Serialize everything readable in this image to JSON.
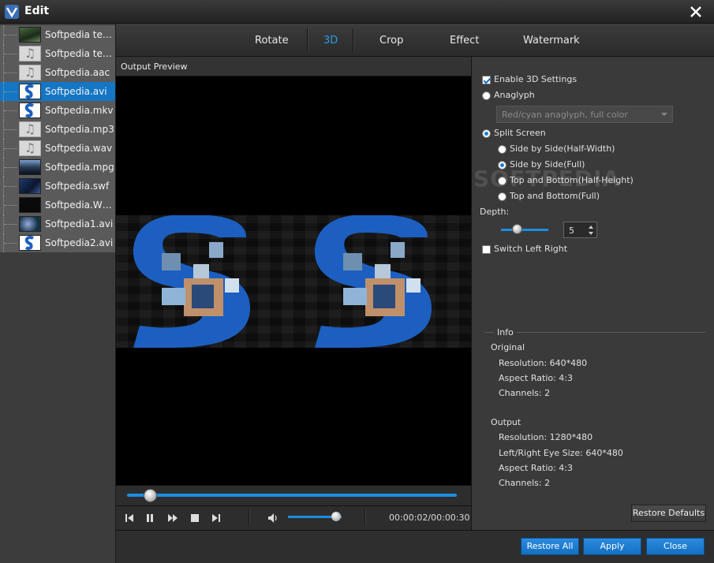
{
  "window": {
    "title": "Edit"
  },
  "files": [
    {
      "name": "Softpedia test ...",
      "thumb": "nature"
    },
    {
      "name": "Softpedia test....",
      "thumb": "note"
    },
    {
      "name": "Softpedia.aac",
      "thumb": "note"
    },
    {
      "name": "Softpedia.avi",
      "thumb": "logo",
      "selected": true
    },
    {
      "name": "Softpedia.mkv",
      "thumb": "logo"
    },
    {
      "name": "Softpedia.mp3",
      "thumb": "note"
    },
    {
      "name": "Softpedia.wav",
      "thumb": "note"
    },
    {
      "name": "Softpedia.mpg",
      "thumb": "city"
    },
    {
      "name": "Softpedia.swf",
      "thumb": "video"
    },
    {
      "name": "Softpedia.WMV",
      "thumb": "dark"
    },
    {
      "name": "Softpedia1.avi",
      "thumb": "sea"
    },
    {
      "name": "Softpedia2.avi",
      "thumb": "logo"
    }
  ],
  "tabs": [
    {
      "label": "Rotate"
    },
    {
      "label": "3D",
      "active": true
    },
    {
      "label": "Crop"
    },
    {
      "label": "Effect"
    },
    {
      "label": "Watermark"
    }
  ],
  "preview": {
    "label": "Output Preview",
    "seek_progress": 0.07,
    "volume": 0.9
  },
  "playback": {
    "time": "00:00:02/00:00:30"
  },
  "settings": {
    "enable_3d": {
      "label": "Enable 3D Settings",
      "checked": true
    },
    "anaglyph": {
      "label": "Anaglyph",
      "selected": false
    },
    "anaglyph_mode": "Red/cyan anaglyph, full color",
    "split_screen": {
      "label": "Split Screen",
      "selected": true
    },
    "split_options": [
      {
        "label": "Side by Side(Half-Width)",
        "selected": false
      },
      {
        "label": "Side by Side(Full)",
        "selected": true
      },
      {
        "label": "Top and Bottom(Half-Height)",
        "selected": false
      },
      {
        "label": "Top and Bottom(Full)",
        "selected": false
      }
    ],
    "depth_label": "Depth:",
    "depth_value": "5",
    "switch_left_right": {
      "label": "Switch Left Right",
      "checked": false
    }
  },
  "info": {
    "title": "Info",
    "original_label": "Original",
    "original": [
      "Resolution: 640*480",
      "Aspect Ratio: 4:3",
      "Channels: 2"
    ],
    "output_label": "Output",
    "output": [
      "Resolution: 1280*480",
      "Left/Right Eye Size: 640*480",
      "Aspect Ratio: 4:3",
      "Channels: 2"
    ]
  },
  "buttons": {
    "restore_defaults": "Restore Defaults",
    "restore_all": "Restore All",
    "apply": "Apply",
    "close": "Close"
  },
  "watermark": "SOFTPEDIA",
  "colors": {
    "accent": "#1a8fe0",
    "selected": "#1476c4",
    "background": "#2b2b2b"
  }
}
